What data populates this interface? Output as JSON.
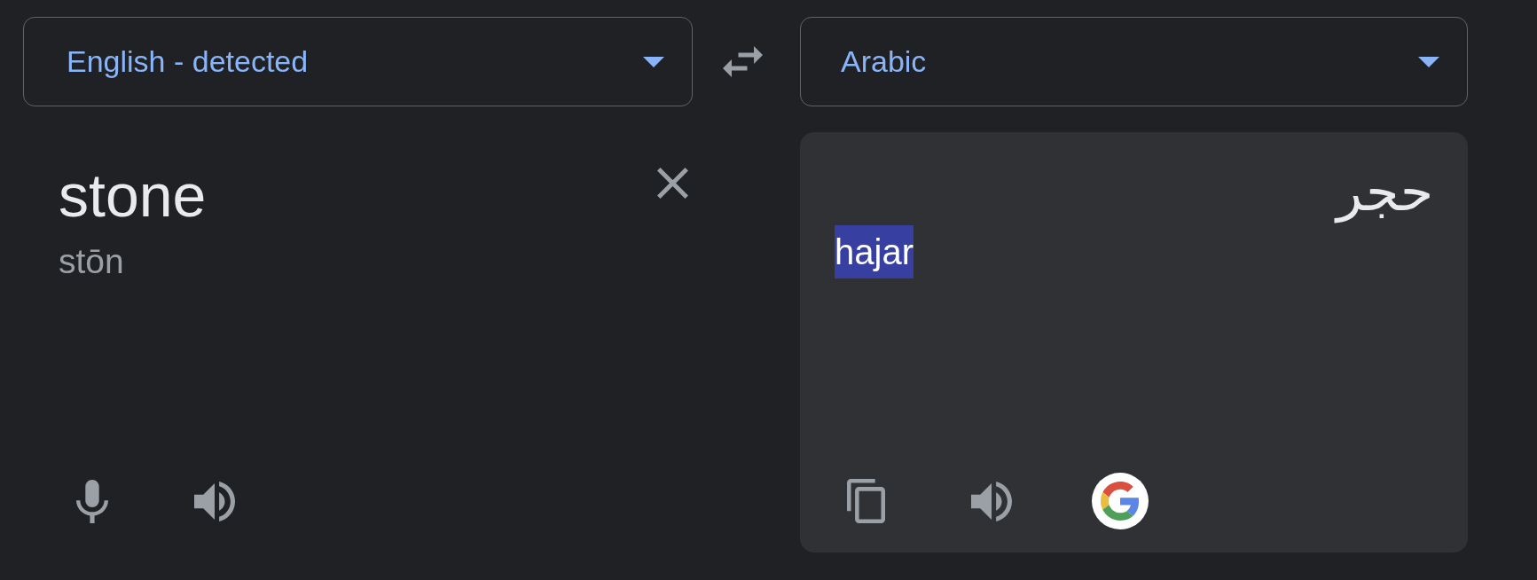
{
  "source_language": {
    "label": "English - detected"
  },
  "target_language": {
    "label": "Arabic"
  },
  "source": {
    "text": "stone",
    "transliteration": "stōn"
  },
  "translation": {
    "text": "حجر",
    "transliteration": {
      "text": "hajar",
      "highlighted": true
    }
  }
}
